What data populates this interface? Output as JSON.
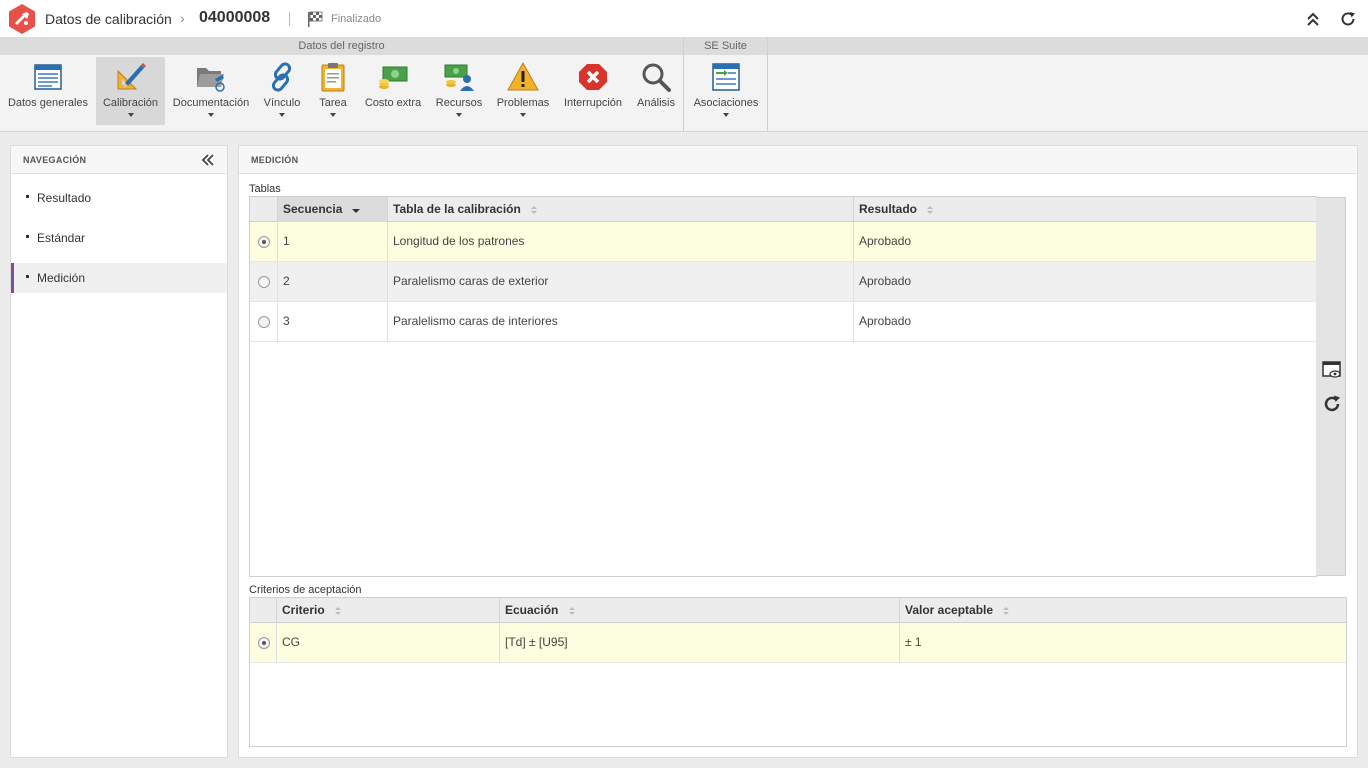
{
  "header": {
    "title": "Datos de calibración",
    "separator": "›",
    "record_id": "04000008",
    "status": "Finalizado"
  },
  "ribbon": {
    "groups": [
      {
        "label": "Datos del registro"
      },
      {
        "label": "SE Suite"
      }
    ],
    "buttons": [
      {
        "label": "Datos generales",
        "icon": "form-icon"
      },
      {
        "label": "Calibración",
        "icon": "ruler-pencil-icon"
      },
      {
        "label": "Documentación",
        "icon": "folder-icon"
      },
      {
        "label": "Vínculo",
        "icon": "link-icon"
      },
      {
        "label": "Tarea",
        "icon": "clipboard-icon"
      },
      {
        "label": "Costo extra",
        "icon": "money-icon"
      },
      {
        "label": "Recursos",
        "icon": "resources-icon"
      },
      {
        "label": "Problemas",
        "icon": "warning-icon"
      },
      {
        "label": "Interrupción",
        "icon": "stop-icon"
      },
      {
        "label": "Análisis",
        "icon": "magnifier-icon"
      },
      {
        "label": "Asociaciones",
        "icon": "associations-icon"
      }
    ]
  },
  "navigation": {
    "title": "NAVEGACIÓN",
    "items": [
      {
        "label": "Resultado"
      },
      {
        "label": "Estándar"
      },
      {
        "label": "Medición"
      }
    ],
    "active_index": 2,
    "accent_color": "#7b4ea3"
  },
  "main": {
    "title": "MEDICIÓN",
    "tables_label": "Tablas",
    "tables": {
      "columns": [
        "Secuencia",
        "Tabla de la calibración",
        "Resultado"
      ],
      "rows": [
        {
          "seq": "1",
          "table": "Longitud de los patrones",
          "result": "Aprobado",
          "selected": true
        },
        {
          "seq": "2",
          "table": "Paralelismo caras de exterior",
          "result": "Aprobado",
          "selected": false
        },
        {
          "seq": "3",
          "table": "Paralelismo caras de interiores",
          "result": "Aprobado",
          "selected": false
        }
      ]
    },
    "criteria_label": "Criterios de aceptación",
    "criteria": {
      "columns": [
        "Criterio",
        "Ecuación",
        "Valor aceptable"
      ],
      "rows": [
        {
          "criterion": "CG",
          "equation": "[Td] ± [U95]",
          "value": "± 1",
          "selected": true
        }
      ]
    }
  },
  "colors": {
    "logo": "#e8514a",
    "selected_row": "#fdfde0"
  }
}
